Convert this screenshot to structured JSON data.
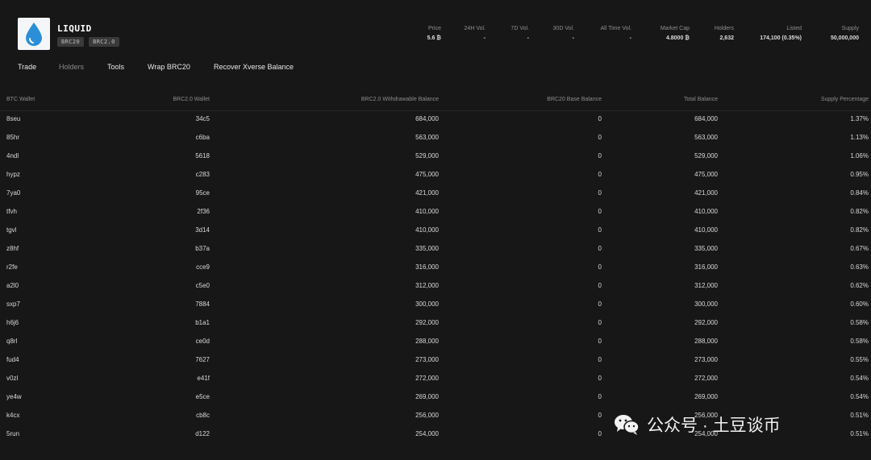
{
  "token": {
    "name": "LIQUID",
    "badges": [
      "BRC20",
      "BRC2.0"
    ]
  },
  "stats": [
    {
      "label": "Price",
      "value": "5.6 ₿"
    },
    {
      "label": "24H Vol.",
      "value": "-"
    },
    {
      "label": "7D Vol.",
      "value": "-"
    },
    {
      "label": "30D Vol.",
      "value": "-"
    },
    {
      "label": "All Time Vol.",
      "value": "-"
    },
    {
      "label": "Market Cap",
      "value": "4.8000 ₿"
    },
    {
      "label": "Holders",
      "value": "2,632"
    },
    {
      "label": "Listed",
      "value": "174,100 (0.35%)"
    },
    {
      "label": "Supply",
      "value": "50,000,000"
    }
  ],
  "tabs": [
    {
      "label": "Trade",
      "active": true
    },
    {
      "label": "Holders",
      "active": false
    },
    {
      "label": "Tools",
      "active": true
    },
    {
      "label": "Wrap BRC20",
      "active": true
    },
    {
      "label": "Recover Xverse Balance",
      "active": true
    }
  ],
  "table": {
    "columns": [
      "BTC Wallet",
      "BRC2.0 Wallet",
      "BRC2.0 Withdrawable Balance",
      "BRC20 Base Balance",
      "Total Balance",
      "Supply Percentage"
    ],
    "rows": [
      [
        "8seu",
        "34c5",
        "684,000",
        "0",
        "684,000",
        "1.37%"
      ],
      [
        "85hr",
        "c6ba",
        "563,000",
        "0",
        "563,000",
        "1.13%"
      ],
      [
        "4ndl",
        "5618",
        "529,000",
        "0",
        "529,000",
        "1.06%"
      ],
      [
        "hypz",
        "c283",
        "475,000",
        "0",
        "475,000",
        "0.95%"
      ],
      [
        "7ya0",
        "95ce",
        "421,000",
        "0",
        "421,000",
        "0.84%"
      ],
      [
        "tfvh",
        "2f36",
        "410,000",
        "0",
        "410,000",
        "0.82%"
      ],
      [
        "tgvl",
        "3d14",
        "410,000",
        "0",
        "410,000",
        "0.82%"
      ],
      [
        "z8hf",
        "b37a",
        "335,000",
        "0",
        "335,000",
        "0.67%"
      ],
      [
        "r2fe",
        "cce9",
        "316,000",
        "0",
        "316,000",
        "0.63%"
      ],
      [
        "a2l0",
        "c5e0",
        "312,000",
        "0",
        "312,000",
        "0.62%"
      ],
      [
        "sxp7",
        "7884",
        "300,000",
        "0",
        "300,000",
        "0.60%"
      ],
      [
        "h6j6",
        "b1a1",
        "292,000",
        "0",
        "292,000",
        "0.58%"
      ],
      [
        "q8rl",
        "ce0d",
        "288,000",
        "0",
        "288,000",
        "0.58%"
      ],
      [
        "fud4",
        "7627",
        "273,000",
        "0",
        "273,000",
        "0.55%"
      ],
      [
        "v0zl",
        "e41f",
        "272,000",
        "0",
        "272,000",
        "0.54%"
      ],
      [
        "ye4w",
        "e5ce",
        "269,000",
        "0",
        "269,000",
        "0.54%"
      ],
      [
        "k4cx",
        "cb8c",
        "256,000",
        "0",
        "256,000",
        "0.51%"
      ],
      [
        "5run",
        "d122",
        "254,000",
        "0",
        "254,000",
        "0.51%"
      ]
    ]
  },
  "watermark": {
    "text": "公众号 · 土豆谈币",
    "icon": "wechat-icon"
  },
  "colors": {
    "background": "#171717",
    "logo_bg": "#f4f6f9",
    "drop": "#2a8fd8"
  }
}
